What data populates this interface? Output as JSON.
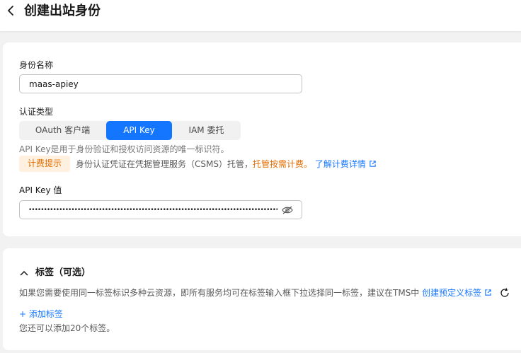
{
  "header": {
    "title": "创建出站身份"
  },
  "form": {
    "name": {
      "label": "身份名称",
      "value": "maas-apiey"
    },
    "auth_type": {
      "label": "认证类型",
      "options": [
        "OAuth 客户端",
        "API Key",
        "IAM 委托"
      ],
      "selected": "API Key"
    },
    "auth_hint": "API Key是用于身份验证和授权访问资源的唯一标识符。",
    "billing": {
      "badge": "计费提示",
      "text": "身份认证凭证在凭据管理服务（CSMS）托管，",
      "highlight": "托管按需计费。",
      "link": "了解计费详情"
    },
    "api_key": {
      "label": "API Key 值",
      "masked_value": "••••••••••••••••••••••••••••••••••••••••••••••••••••••••••••••••••••••••••••••••••"
    }
  },
  "tags": {
    "title": "标签（可选）",
    "description": "如果您需要使用同一标签标识多种云资源，即所有服务均可在标签输入框下拉选择同一标签，建议在TMS中",
    "create_link": "创建预定义标签",
    "add_button": "+ 添加标签",
    "note": "您还可以添加20个标签。"
  },
  "colors": {
    "primary": "#1476ff",
    "warning": "#e06d00",
    "badge_bg": "#fff0e0"
  }
}
